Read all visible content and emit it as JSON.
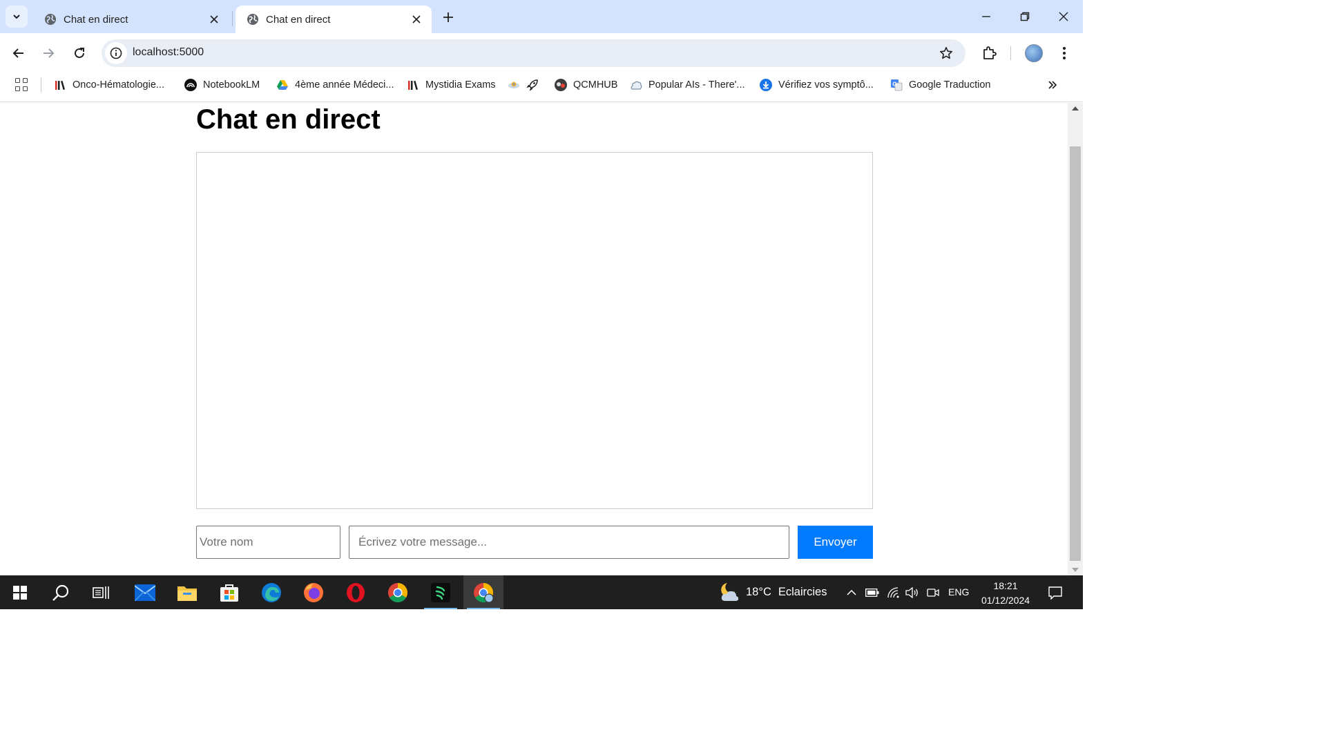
{
  "browser": {
    "tabs": [
      {
        "title": "Chat en direct",
        "active": false
      },
      {
        "title": "Chat en direct",
        "active": true
      }
    ],
    "address": "localhost:5000",
    "bookmarks": [
      {
        "label": "Onco-Hématologie...",
        "icon": "books-icon"
      },
      {
        "label": "NotebookLM",
        "icon": "notebooklm-icon"
      },
      {
        "label": "4ème année Médeci...",
        "icon": "google-drive-icon"
      },
      {
        "label": "Mystidia Exams",
        "icon": "books-icon"
      },
      {
        "label": "",
        "icon": "extension-bookmark-icon"
      },
      {
        "label": "",
        "icon": "rocket-icon"
      },
      {
        "label": "QCMHUB",
        "icon": "qcmhub-icon"
      },
      {
        "label": "Popular AIs - There'...",
        "icon": "cloud-hand-icon"
      },
      {
        "label": "Vérifiez vos symptô...",
        "icon": "download-circle-icon"
      },
      {
        "label": "Google Traduction",
        "icon": "google-translate-icon"
      }
    ]
  },
  "page": {
    "title": "Chat en direct",
    "name_placeholder": "Votre nom",
    "message_placeholder": "Écrivez votre message...",
    "send_label": "Envoyer"
  },
  "taskbar": {
    "weather_temp": "18°C",
    "weather_desc": "Eclaircies",
    "language": "ENG",
    "time": "18:21",
    "date": "01/12/2024"
  },
  "colors": {
    "send_button": "#007bff",
    "tab_strip": "#d3e3fd",
    "omnibox": "#e9eef6",
    "taskbar": "#1f1f1f"
  }
}
